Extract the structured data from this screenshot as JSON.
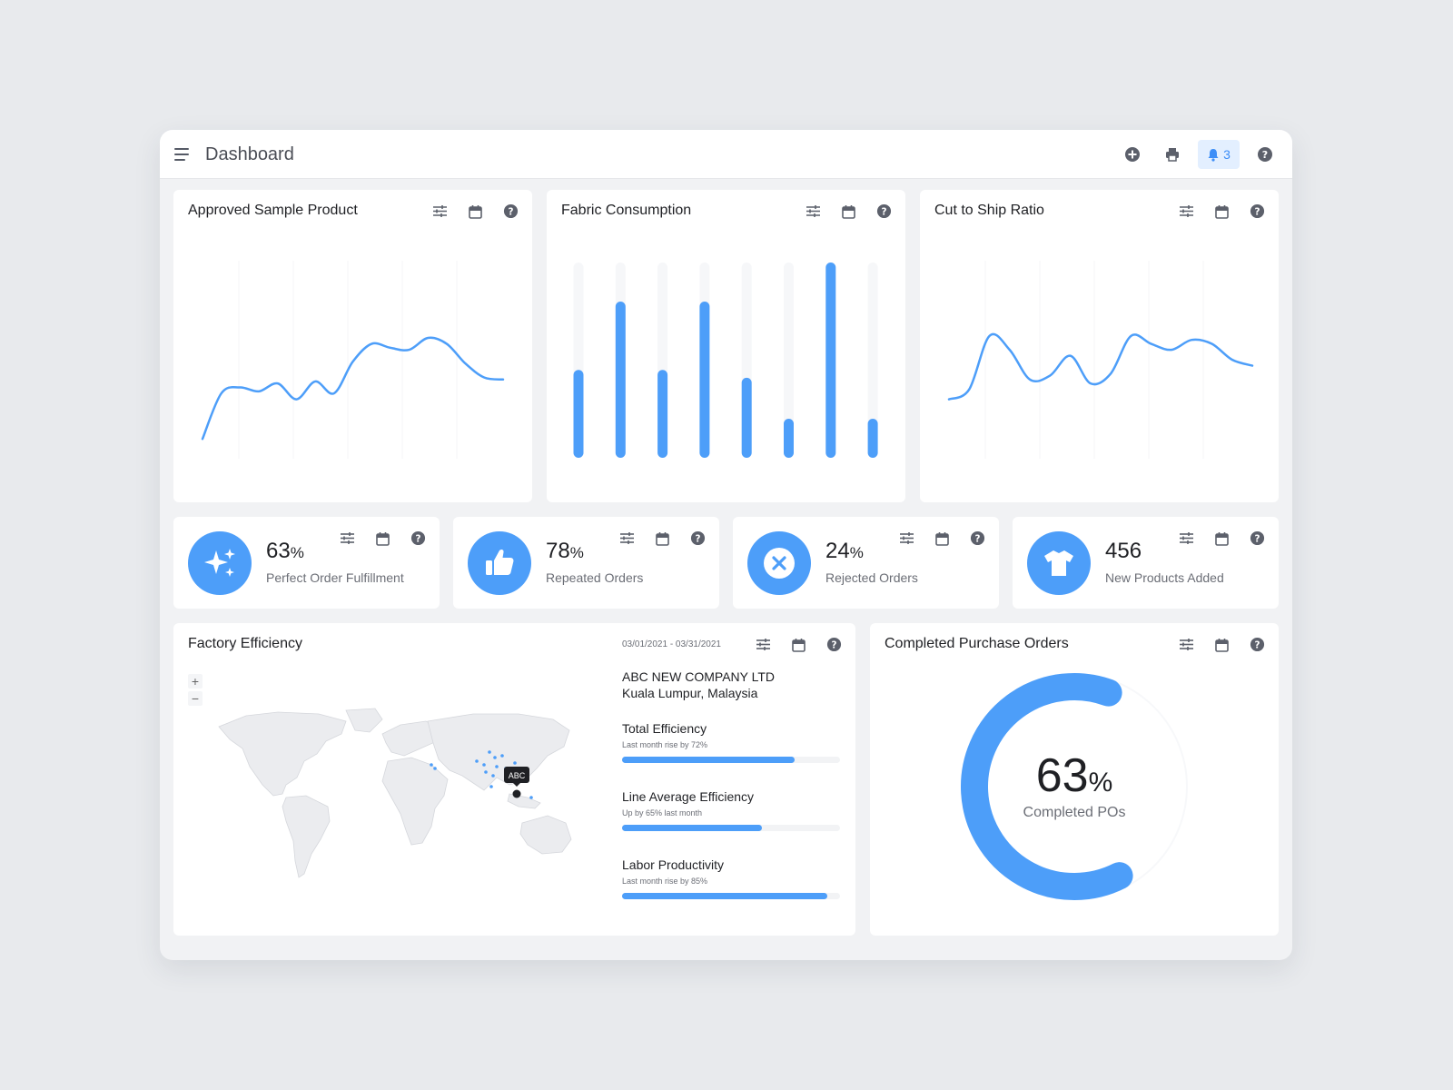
{
  "header": {
    "title": "Dashboard",
    "notification_count": "3",
    "icons": [
      "add-circle-icon",
      "print-icon",
      "bell-icon",
      "help-icon"
    ]
  },
  "colors": {
    "accent": "#4d9ef9",
    "background": "#e8eaed",
    "panel": "#f1f2f4",
    "text": "#1f2024",
    "muted": "#6b6e76"
  },
  "cards": {
    "approved": {
      "title": "Approved Sample Product"
    },
    "fabric": {
      "title": "Fabric Consumption"
    },
    "cut_ship": {
      "title": "Cut to Ship Ratio"
    }
  },
  "stats": [
    {
      "value": "63",
      "unit": "%",
      "label": "Perfect Order Fulfillment",
      "icon": "sparkle-icon"
    },
    {
      "value": "78",
      "unit": "%",
      "label": "Repeated Orders",
      "icon": "thumbs-up-icon"
    },
    {
      "value": "24",
      "unit": "%",
      "label": "Rejected Orders",
      "icon": "close-circle-icon"
    },
    {
      "value": "456",
      "unit": "",
      "label": "New Products Added",
      "icon": "tshirt-icon"
    }
  ],
  "factory": {
    "title": "Factory Efficiency",
    "date_range": "03/01/2021 - 03/31/2021",
    "zoom_in": "+",
    "zoom_out": "−",
    "company_name": "ABC NEW COMPANY LTD",
    "company_location": "Kuala Lumpur, Malaysia",
    "marker_label": "ABC",
    "metrics": [
      {
        "name": "Total Efficiency",
        "sub": "Last month rise by 72%",
        "fill": 0.79
      },
      {
        "name": "Line Average Efficiency",
        "sub": "Up by 65% last month",
        "fill": 0.64
      },
      {
        "name": "Labor Productivity",
        "sub": "Last month rise by 85%",
        "fill": 0.94
      }
    ]
  },
  "completed_po": {
    "title": "Completed Purchase Orders",
    "value": "63",
    "unit": "%",
    "label": "Completed POs",
    "percent": 63
  },
  "chart_data": [
    {
      "type": "line",
      "title": "Approved Sample Product",
      "x": [
        0,
        1,
        2,
        3,
        4,
        5,
        6,
        7,
        8,
        9,
        10,
        11,
        12,
        13,
        14,
        15,
        16
      ],
      "values": [
        10,
        33,
        36,
        34,
        38,
        30,
        39,
        33,
        49,
        58,
        56,
        55,
        61,
        58,
        48,
        41,
        40
      ],
      "ylim": [
        0,
        100
      ],
      "grid": true
    },
    {
      "type": "bar",
      "title": "Fabric Consumption",
      "categories": [
        "1",
        "2",
        "3",
        "4",
        "5",
        "6",
        "7",
        "8"
      ],
      "values": [
        45,
        80,
        45,
        80,
        41,
        20,
        100,
        20
      ],
      "ylim": [
        0,
        100
      ]
    },
    {
      "type": "line",
      "title": "Cut to Ship Ratio",
      "x": [
        0,
        1,
        2,
        3,
        4,
        5,
        6,
        7,
        8,
        9,
        10,
        11,
        12,
        13,
        14,
        15
      ],
      "values": [
        30,
        35,
        62,
        55,
        40,
        42,
        52,
        38,
        43,
        62,
        58,
        55,
        60,
        58,
        50,
        47
      ],
      "ylim": [
        0,
        100
      ],
      "grid": true
    },
    {
      "type": "pie",
      "title": "Completed Purchase Orders",
      "values": [
        63,
        37
      ]
    }
  ]
}
